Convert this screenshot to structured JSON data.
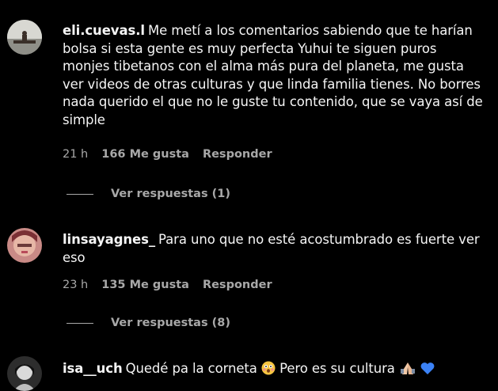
{
  "comments": [
    {
      "username": "eli.cuevas.l",
      "text": "Me metí a los comentarios sabiendo que te harían bolsa si esta gente es muy perfecta Yuhui te siguen puros monjes tibetanos con el alma más pura del planeta, me gusta ver videos de otras culturas y que linda familia tienes. No borres nada querido el que no le guste tu contenido, que se vaya así de simple",
      "time": "21 h",
      "likes": "166 Me gusta",
      "reply": "Responder",
      "view_replies": "Ver respuestas (1)"
    },
    {
      "username": "linsayagnes_",
      "text": "Para uno que no esté acostumbrado es fuerte ver eso",
      "time": "23 h",
      "likes": "135 Me gusta",
      "reply": "Responder",
      "view_replies": "Ver respuestas (8)"
    },
    {
      "username": "isa__uch",
      "text_before": "Quedé pa la corneta",
      "text_middle": "Pero es su cultura",
      "emoji_1": "astonished-face-emoji",
      "emoji_2": "praying-hands-emoji",
      "emoji_3": "blue-heart-emoji"
    }
  ],
  "colors": {
    "background": "#000000",
    "text": "#f5f5f5",
    "secondary": "#a8a8a8",
    "heart_blue": "#3b82f6"
  }
}
